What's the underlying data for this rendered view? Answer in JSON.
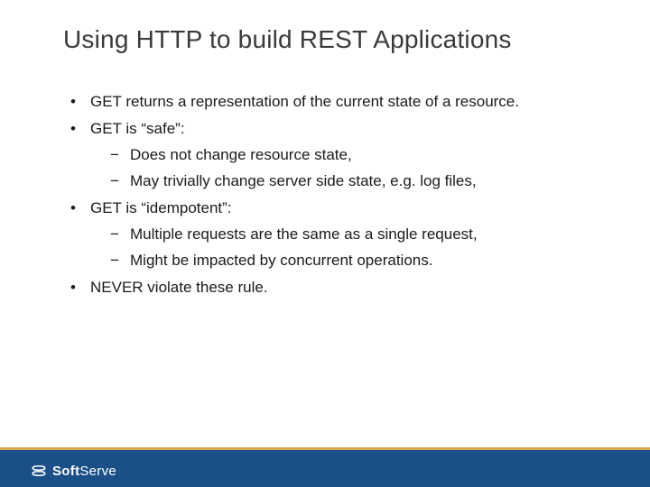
{
  "title": "Using HTTP to build REST Applications",
  "bullets": {
    "b1": "GET returns a representation of the current state of a resource.",
    "b2": "GET is “safe”:",
    "b2a": "Does not change resource state,",
    "b2b": "May trivially change server side state, e.g. log files,",
    "b3": "GET is “idempotent”:",
    "b3a": "Multiple requests are the same as a single request,",
    "b3b": "Might be impacted by concurrent operations.",
    "b4": "NEVER violate these rule."
  },
  "brand": {
    "name_bold": "Soft",
    "name_light": "Serve"
  }
}
